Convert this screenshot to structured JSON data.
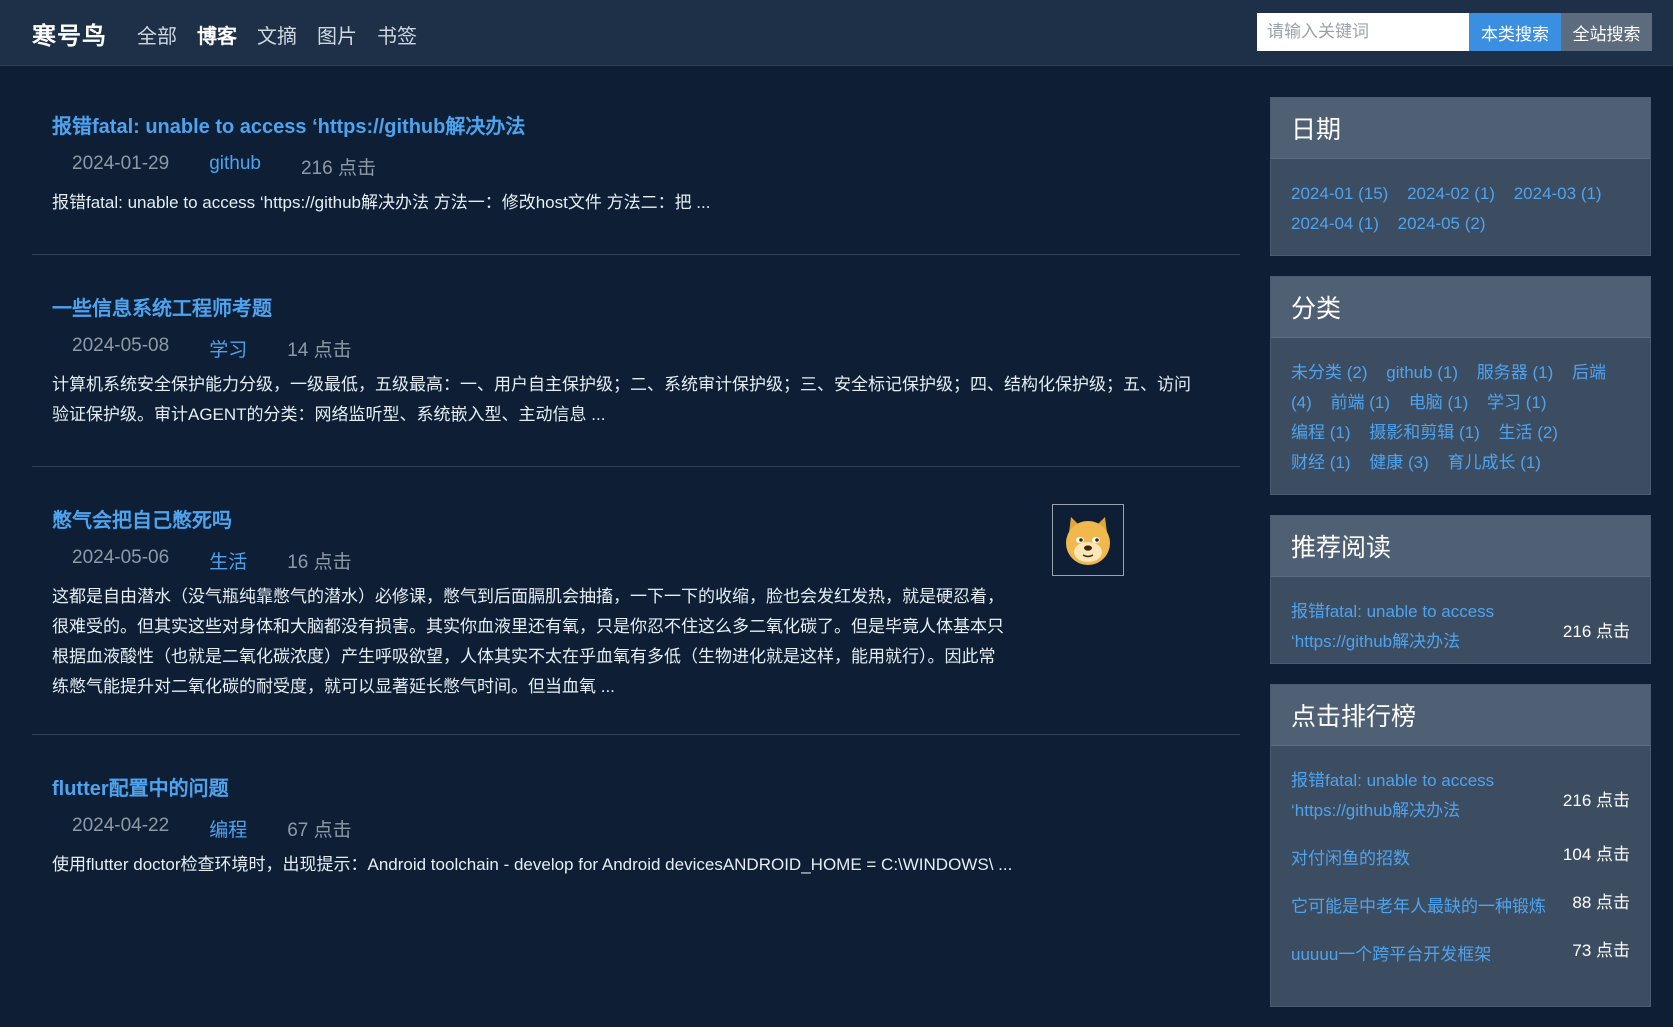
{
  "header": {
    "brand": "寒号鸟",
    "nav": [
      {
        "label": "全部"
      },
      {
        "label": "博客"
      },
      {
        "label": "文摘"
      },
      {
        "label": "图片"
      },
      {
        "label": "书签"
      }
    ],
    "active_nav": "博客",
    "search": {
      "placeholder": "请输入关键词",
      "value": "",
      "local_label": "本类搜索",
      "global_label": "全站搜索"
    }
  },
  "posts": [
    {
      "title": "报错fatal: unable to access ‘https://github解决办法",
      "date": "2024-01-29",
      "category": "github",
      "clicks": "216 点击",
      "excerpt": "报错fatal: unable to access ‘https://github解决办法   方法一：修改host文件   方法二：把 ..."
    },
    {
      "title": "一些信息系统工程师考题",
      "date": "2024-05-08",
      "category": "学习",
      "clicks": "14 点击",
      "excerpt": "计算机系统安全保护能力分级，一级最低，五级最高：一、用户自主保护级；二、系统审计保护级；三、安全标记保护级；四、结构化保护级；五、访问验证保护级。审计AGENT的分类：网络监听型、系统嵌入型、主动信息 ..."
    },
    {
      "title": "憋气会把自己憋死吗",
      "date": "2024-05-06",
      "category": "生活",
      "clicks": "16 点击",
      "excerpt": "这都是自由潜水（没气瓶纯靠憋气的潜水）必修课，憋气到后面膈肌会抽搐，一下一下的收缩，脸也会发红发热，就是硬忍着，很难受的。但其实这些对身体和大脑都没有损害。其实你血液里还有氧，只是你忍不住这么多二氧化碳了。但是毕竟人体基本只根据血液酸性（也就是二氧化碳浓度）产生呼吸欲望，人体其实不太在乎血氧有多低（生物进化就是这样，能用就行）。因此常练憋气能提升对二氧化碳的耐受度，就可以显著延长憋气时间。但当血氧 ...",
      "thumbnail_icon": "doge-face-icon"
    },
    {
      "title": "flutter配置中的问题",
      "date": "2024-04-22",
      "category": "编程",
      "clicks": "67 点击",
      "excerpt": "使用flutter doctor检查环境时，出现提示：Android toolchain - develop for Android devicesANDROID_HOME = C:\\WINDOWS\\ ..."
    }
  ],
  "sidebar": {
    "dates": {
      "title": "日期",
      "items": [
        "2024-01 (15)",
        "2024-02 (1)",
        "2024-03 (1)",
        "2024-04 (1)",
        "2024-05 (2)"
      ]
    },
    "categories": {
      "title": "分类",
      "items": [
        "未分类 (2)",
        "github (1)",
        "服务器 (1)",
        "后端 (4)",
        "前端 (1)",
        "电脑 (1)",
        "学习 (1)",
        "编程 (1)",
        "摄影和剪辑 (1)",
        "生活 (2)",
        "财经 (1)",
        "健康 (3)",
        "育儿成长 (1)"
      ]
    },
    "recommended": {
      "title": "推荐阅读",
      "items": [
        {
          "title": "报错fatal: unable to access ‘https://github解决办法",
          "clicks": "216 点击"
        }
      ]
    },
    "ranking": {
      "title": "点击排行榜",
      "items": [
        {
          "title": "报错fatal: unable to access ‘https://github解决办法",
          "clicks": "216 点击"
        },
        {
          "title": "对付闲鱼的招数",
          "clicks": "104 点击"
        },
        {
          "title": "它可能是中老年人最缺的一种锻炼",
          "clicks": "88 点击"
        },
        {
          "title": "uuuuu一个跨平台开发框架",
          "clicks": "73 点击"
        }
      ]
    }
  },
  "colors": {
    "background": "#0e1f35",
    "topbar": "#1e3047",
    "link": "#4ea3ef",
    "local_search_button": "#3b8fe0",
    "panel": "#3c4d62"
  }
}
